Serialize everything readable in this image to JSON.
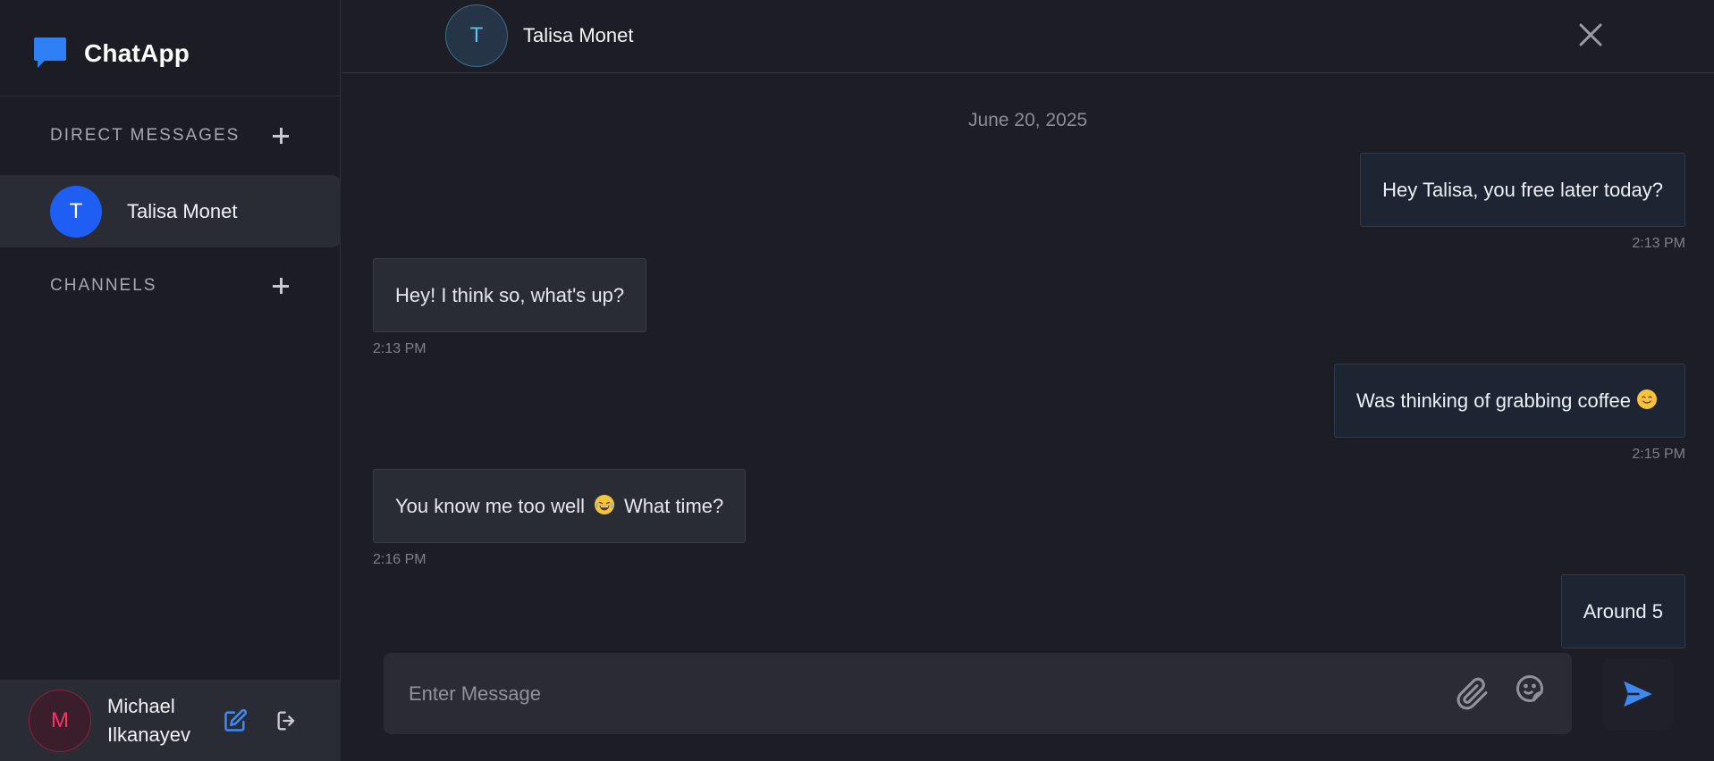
{
  "app": {
    "name": "ChatApp"
  },
  "sidebar": {
    "direct_messages_title": "DIRECT MESSAGES",
    "channels_title": "CHANNELS",
    "dm_items": [
      {
        "initial": "T",
        "label": "Talisa Monet"
      }
    ]
  },
  "user": {
    "initial": "M",
    "name": "Michael Ilkanayev"
  },
  "chat": {
    "contact_initial": "T",
    "contact_name": "Talisa Monet",
    "date": "June 20, 2025",
    "messages": [
      {
        "direction": "out",
        "text": "Hey Talisa, you free later today?",
        "time": "2:13 PM"
      },
      {
        "direction": "in",
        "text": "Hey! I think so, what's up?",
        "time": "2:13 PM"
      },
      {
        "direction": "out",
        "text": "Was thinking of grabbing coffee",
        "emoji": "smiling-face",
        "time": "2:15 PM"
      },
      {
        "direction": "in",
        "text_before": "You know me too well",
        "emoji": "laughing-face",
        "text_after": "What time?",
        "time": "2:16 PM"
      },
      {
        "direction": "out",
        "text": "Around 5"
      }
    ]
  },
  "composer": {
    "placeholder": "Enter Message"
  },
  "colors": {
    "accent": "#1f5ef2",
    "send_icon": "#3d8bf2",
    "user_accent": "#ff2f68"
  }
}
